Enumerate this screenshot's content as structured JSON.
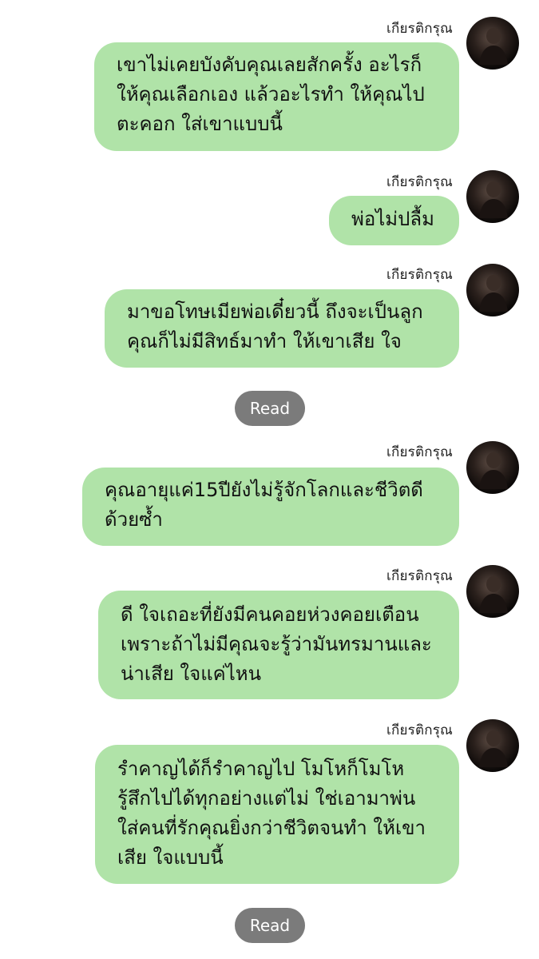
{
  "messages": [
    {
      "sender": "เกียรติกรุณ",
      "lines": [
        "เขาไม่เคยบังคับคุณเลยสักครั้ง อะไรก็",
        "ให้คุณเลือกเอง แล้วอะไรทำ ให้คุณไป",
        "ตะคอก ใส่เขาแบบนี้"
      ]
    },
    {
      "sender": "เกียรติกรุณ",
      "lines": [
        "พ่อไม่ปลื้ม"
      ]
    },
    {
      "sender": "เกียรติกรุณ",
      "lines": [
        "มาขอโทษเมียพ่อเดี๋ยวนี้ ถึงจะเป็นลูก",
        "คุณก็ไม่มีสิทธ์มาทำ ให้เขาเสีย ใจ"
      ]
    },
    {
      "sender": "เกียรติกรุณ",
      "lines": [
        "คุณอายุแค่15ปียังไม่รู้จักโลกและชีวิตดี",
        "ด้วยซ้ำ"
      ]
    },
    {
      "sender": "เกียรติกรุณ",
      "lines": [
        "ดี ใจเถอะที่ยังมีคนคอยห่วงคอยเตือน",
        "เพราะถ้าไม่มีคุณจะรู้ว่ามันทรมานและ",
        "น่าเสีย ใจแค่ไหน"
      ]
    },
    {
      "sender": "เกียรติกรุณ",
      "lines": [
        "รำคาญได้ก็รำคาญไป โมโหก็โมโห",
        "รู้สึกไปได้ทุกอย่างแต่ไม่ ใช่เอามาพ่น",
        "ใส่คนที่รักคุณยิ่งกว่าชีวิตจนทำ ให้เขา",
        "เสีย ใจแบบนี้"
      ]
    }
  ],
  "read_receipts": [
    "Read",
    "Read"
  ],
  "colors": {
    "bubble": "#b0e3a8",
    "read_pill": "#7b7b7b",
    "read_text": "#ffffff",
    "text": "#111111"
  },
  "icons": {
    "avatar": "profile-photo-avatar"
  }
}
